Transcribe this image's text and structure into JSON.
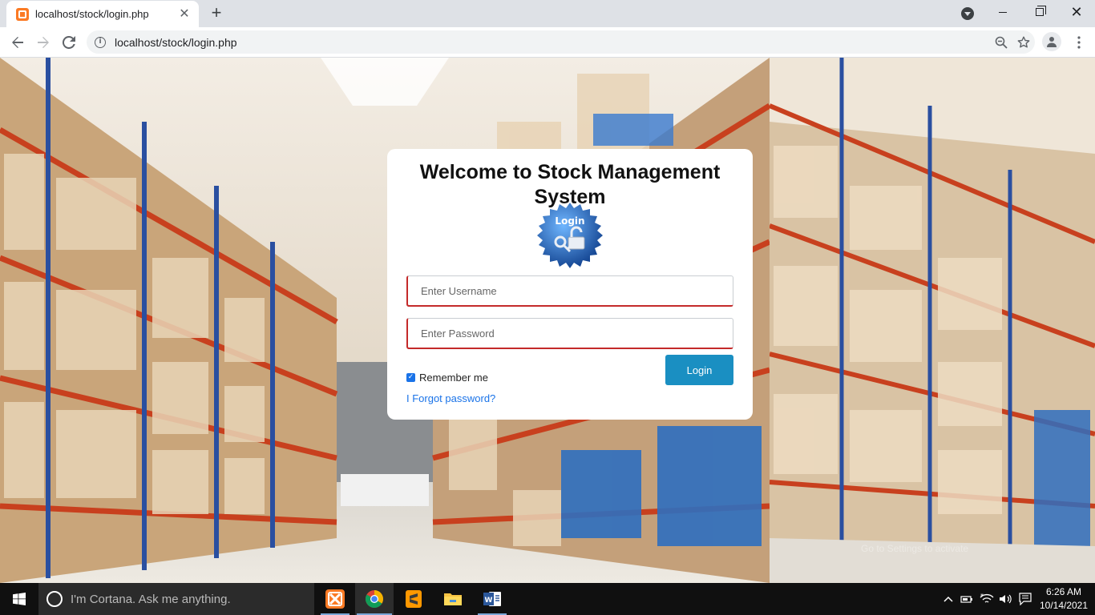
{
  "browser": {
    "tab_title": "localhost/stock/login.php",
    "url": "localhost/stock/login.php"
  },
  "login": {
    "title": "Welcome to Stock Management System",
    "badge_text": "Login",
    "username_placeholder": "Enter Username",
    "password_placeholder": "Enter Password",
    "remember_label": "Remember me",
    "remember_checked": true,
    "forgot_label": "I Forgot password?",
    "login_button": "Login"
  },
  "watermark": {
    "line2": "Go to Settings to activate"
  },
  "taskbar": {
    "cortana_placeholder": "I'm Cortana. Ask me anything.",
    "apps": [
      "xampp-icon",
      "chrome-icon",
      "sublime-text-icon",
      "file-explorer-icon",
      "word-icon"
    ],
    "time": "6:26 AM",
    "date": "10/14/2021"
  },
  "colors": {
    "login_button": "#1a8fc2",
    "field_accent": "#c42a2a",
    "link": "#1a73e8"
  }
}
